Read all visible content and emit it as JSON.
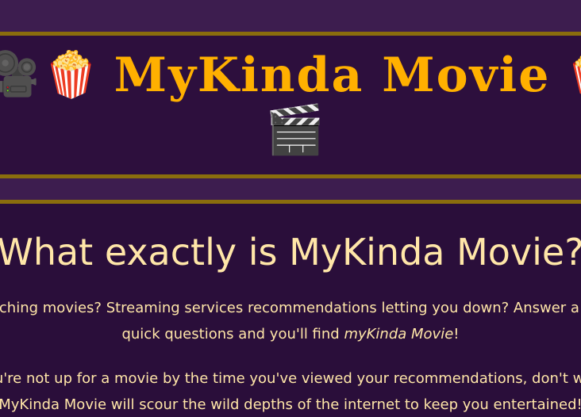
{
  "header": {
    "title": "MyKinda Movie",
    "left_icons": [
      "movie-camera-icon",
      "popcorn-icon"
    ],
    "right_icons": [
      "popcorn-icon"
    ],
    "bottom_icon": "clapper-board-icon"
  },
  "intro": {
    "heading": "What exactly is MyKinda Movie?",
    "para1_line1": "Watching movies? Streaming services recommendations letting you down? Answer a few",
    "para1_line2_start": "quick questions and you'll find ",
    "para1_line2_em": "myKinda Movie",
    "para1_line2_end": "!",
    "para2_line1": "If you're not up for a movie by the time you've viewed your recommendations, don't worry,",
    "para2_line2": "MyKinda Movie will scour the wild depths of the internet to keep you entertained!"
  },
  "colors": {
    "background": "#2a0e3a",
    "strip": "#3d1d4f",
    "rule": "#8a6d0d",
    "title": "#ffb000",
    "text": "#ffe6a8"
  }
}
